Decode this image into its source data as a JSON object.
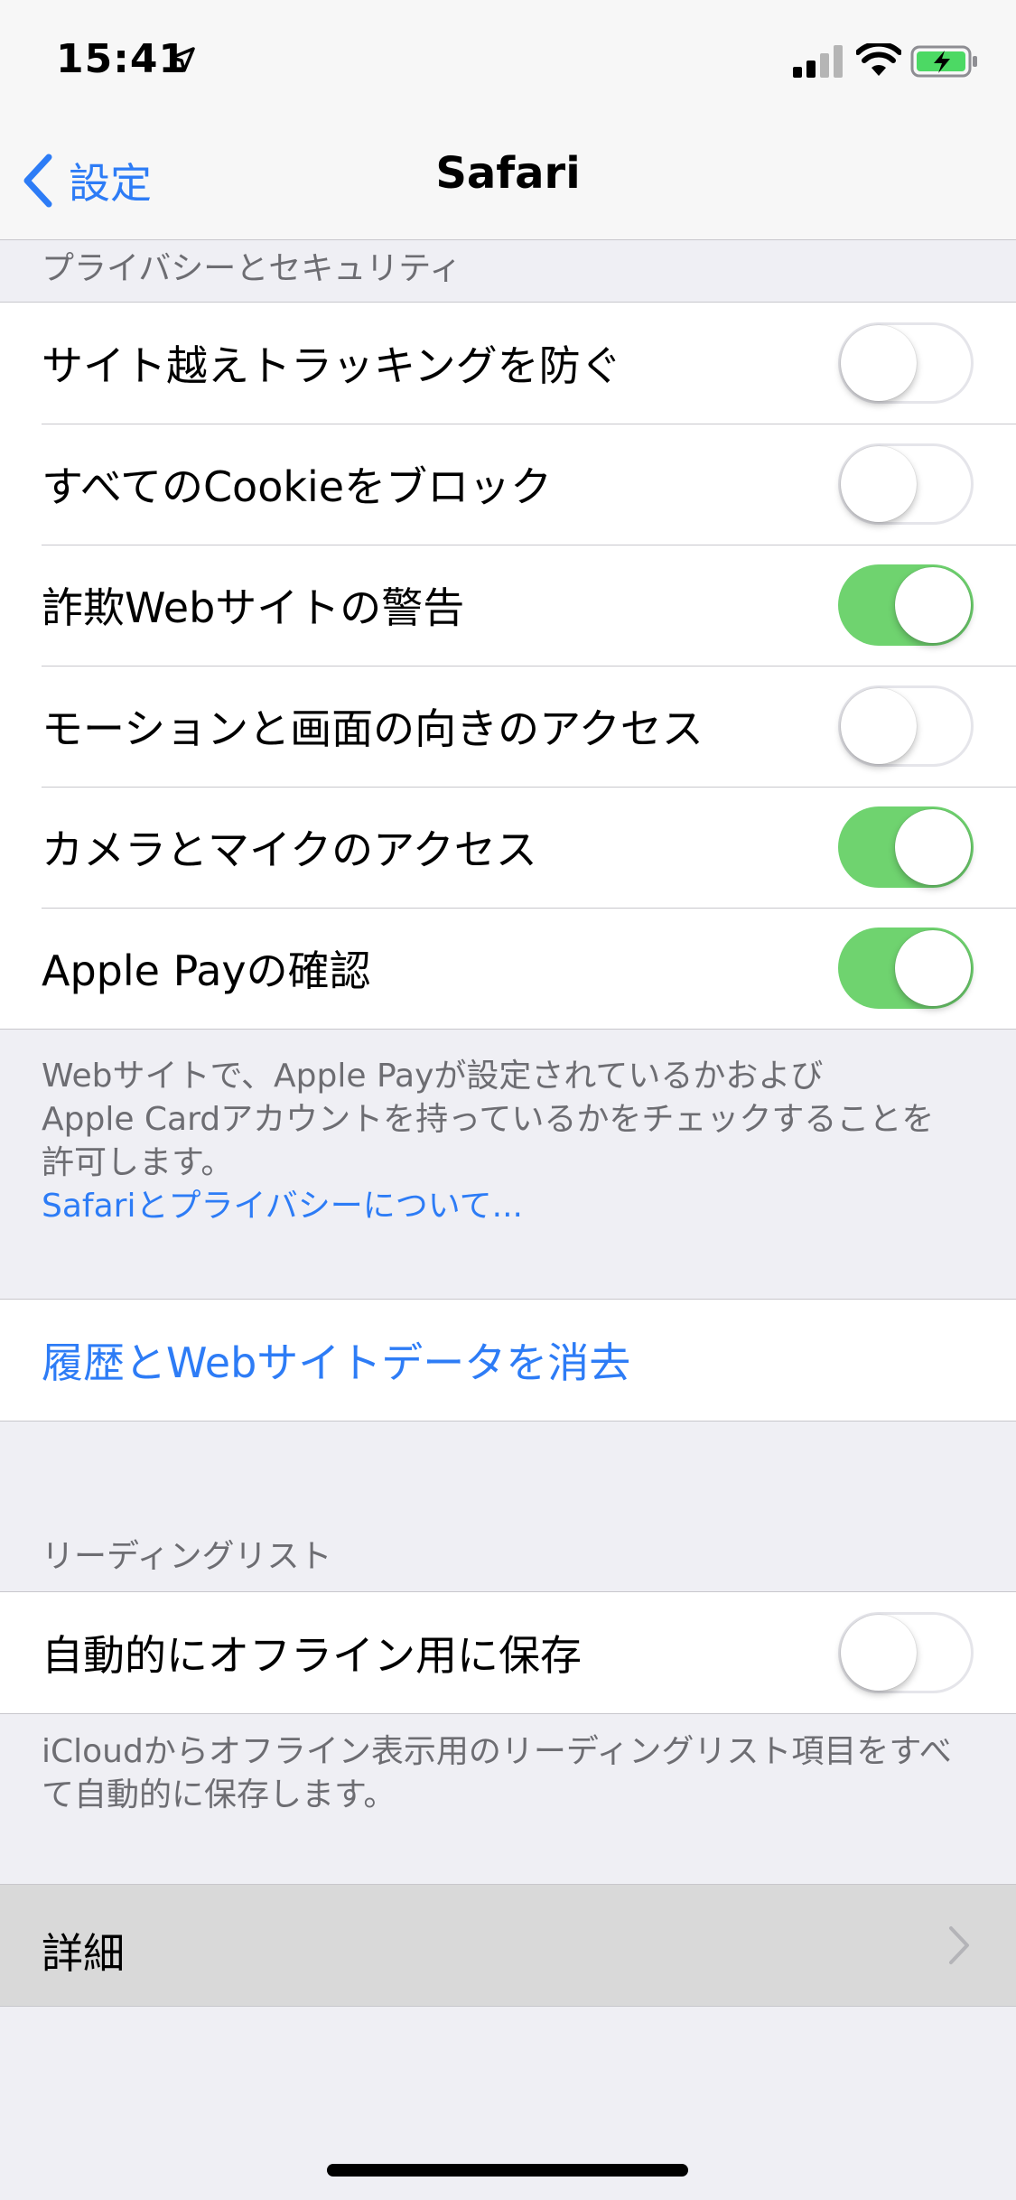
{
  "status_bar": {
    "time": "15:41",
    "icons": [
      "location-arrow-icon",
      "cellular-signal-icon",
      "wifi-icon",
      "battery-charging-icon"
    ]
  },
  "nav": {
    "back_label": "設定",
    "title": "Safari"
  },
  "privacy": {
    "header": "プライバシーとセキュリティ",
    "rows": [
      {
        "label": "サイト越えトラッキングを防ぐ",
        "toggle": false
      },
      {
        "label": "すべてのCookieをブロック",
        "toggle": false
      },
      {
        "label": "詐欺Webサイトの警告",
        "toggle": true
      },
      {
        "label": "モーションと画面の向きのアクセス",
        "toggle": false
      },
      {
        "label": "カメラとマイクのアクセス",
        "toggle": true
      },
      {
        "label": "Apple Payの確認",
        "toggle": true
      }
    ],
    "footer_line1": "Webサイトで、Apple Payが設定されているかおよび",
    "footer_line2": "Apple Cardアカウントを持っているかをチェックすることを",
    "footer_line3": "許可します。",
    "footer_link": "Safariとプライバシーについて..."
  },
  "clear_history": {
    "label": "履歴とWebサイトデータを消去"
  },
  "reading_list": {
    "header": "リーディングリスト",
    "row_label": "自動的にオフライン用に保存",
    "toggle": false,
    "footer_line1": "iCloudからオフライン表示用のリーディングリスト項目をすべ",
    "footer_line2": "て自動的に保存します。"
  },
  "advanced": {
    "label": "詳細"
  },
  "colors": {
    "accent": "#2d7cf6",
    "toggle_on": "#6fd36f",
    "background": "#efeff4"
  }
}
